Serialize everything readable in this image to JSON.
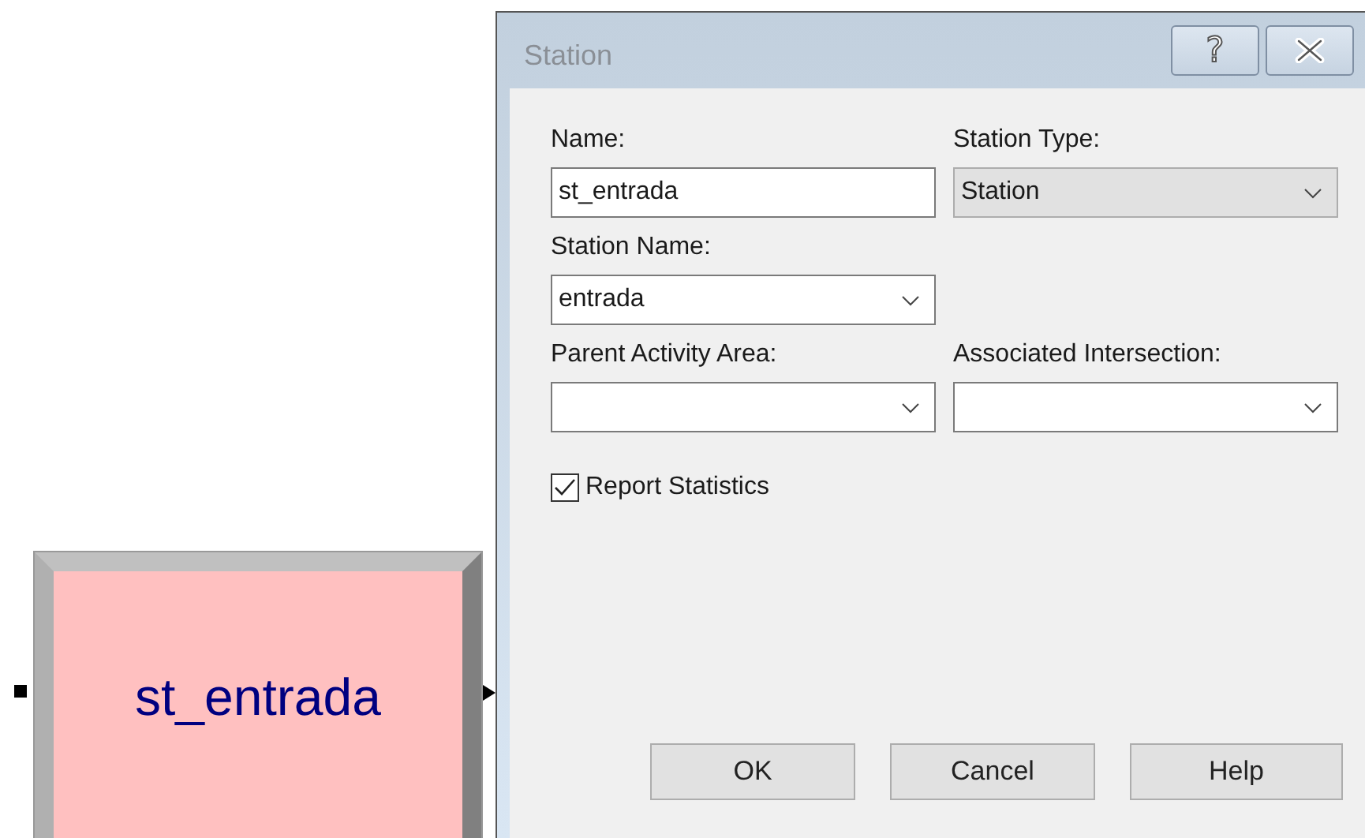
{
  "module": {
    "label": "st_entrada"
  },
  "dialog": {
    "title": "Station",
    "title_buttons": [
      {
        "kind": "help",
        "label": "?"
      },
      {
        "kind": "close"
      }
    ],
    "rows": [
      [
        {
          "label": "Name:",
          "kind": "text",
          "value": "st_entrada"
        },
        {
          "label": "Station Type:",
          "kind": "dropdown",
          "value": "Station"
        }
      ],
      [
        {
          "label": "Station Name:",
          "kind": "combo",
          "value": "entrada"
        }
      ],
      [
        {
          "label": "Parent Activity Area:",
          "kind": "combo"
        },
        {
          "label": "Associated Intersection:",
          "kind": "combo"
        }
      ]
    ],
    "report_statistics": {
      "label": "Report Statistics",
      "checked": true
    },
    "buttons": [
      "OK",
      "Cancel",
      "Help"
    ]
  }
}
